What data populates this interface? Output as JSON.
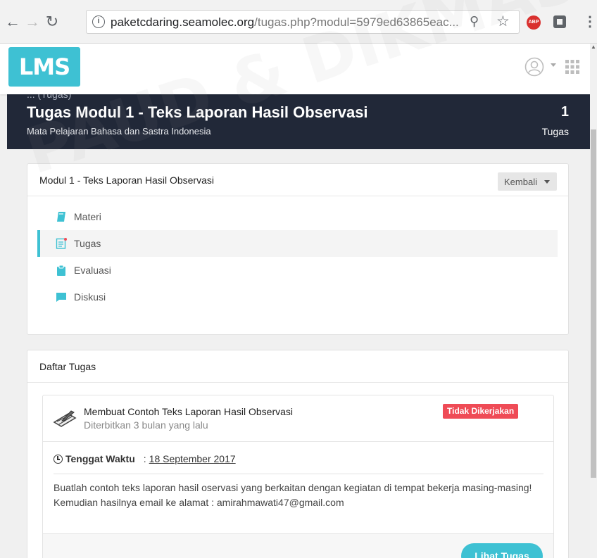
{
  "browser": {
    "url_host": "paketcdaring.seamolec.org",
    "url_path": "/tugas.php?modul=5979ed63865eac..."
  },
  "header": {
    "logo_text": "LMS"
  },
  "banner": {
    "breadcrumb": "...   (Tugas)",
    "title": "Tugas Modul 1 - Teks Laporan Hasil Observasi",
    "subtitle": "Mata Pelajaran Bahasa dan Sastra Indonesia",
    "count": "1",
    "count_label": "Tugas"
  },
  "module": {
    "title": "Modul 1 - Teks Laporan Hasil Observasi",
    "back_label": "Kembali",
    "menu": [
      {
        "label": "Materi",
        "icon": "book-icon"
      },
      {
        "label": "Tugas",
        "icon": "assignment-icon",
        "active": true
      },
      {
        "label": "Evaluasi",
        "icon": "clipboard-icon"
      },
      {
        "label": "Diskusi",
        "icon": "chat-icon"
      }
    ]
  },
  "task_list": {
    "title": "Daftar Tugas",
    "task": {
      "title": "Membuat Contoh Teks Laporan Hasil Observasi",
      "published": "Diterbitkan 3 bulan yang lalu",
      "status": "Tidak Dikerjakan",
      "deadline_label": "Tenggat Waktu",
      "deadline_sep": ":",
      "deadline_value": "18 September 2017",
      "description": "Buatlah  contoh teks laporan hasil oservasi yang berkaitan dengan kegiatan di tempat bekerja masing-masing! Kemudian hasilnya email ke alamat : amirahmawati47@gmail.com",
      "view_label": "Lihat Tugas"
    }
  },
  "watermark": {
    "text": "PAUD & DIKMAS"
  },
  "colors": {
    "accent": "#3ec1d3",
    "banner": "#212838",
    "status_red": "#ef4b56"
  }
}
